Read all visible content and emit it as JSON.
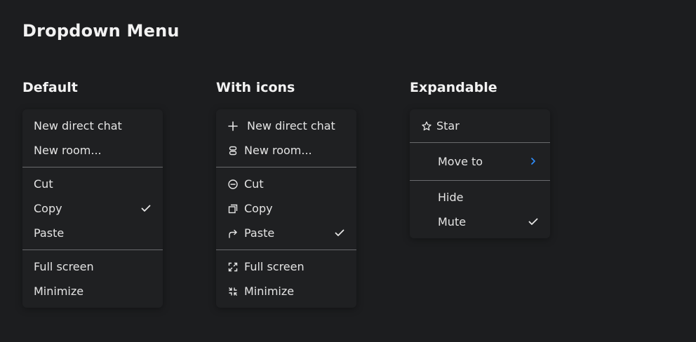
{
  "page_title": "Dropdown Menu",
  "sections": [
    {
      "title": "Default",
      "items": [
        "New direct chat",
        "New room...",
        "Cut",
        "Copy",
        "Paste",
        "Full screen",
        "Minimize"
      ]
    },
    {
      "title": "With icons",
      "items": [
        "New direct chat",
        "New room...",
        "Cut",
        "Copy",
        "Paste",
        "Full screen",
        "Minimize"
      ]
    },
    {
      "title": "Expandable",
      "items": [
        "Star",
        "Move to",
        "Hide",
        "Mute"
      ]
    }
  ],
  "colors": {
    "background": "#1c1d1f",
    "menu_background": "#1f2022",
    "separator": "#6a6b6e",
    "chevron_accent": "#2f8fff"
  }
}
